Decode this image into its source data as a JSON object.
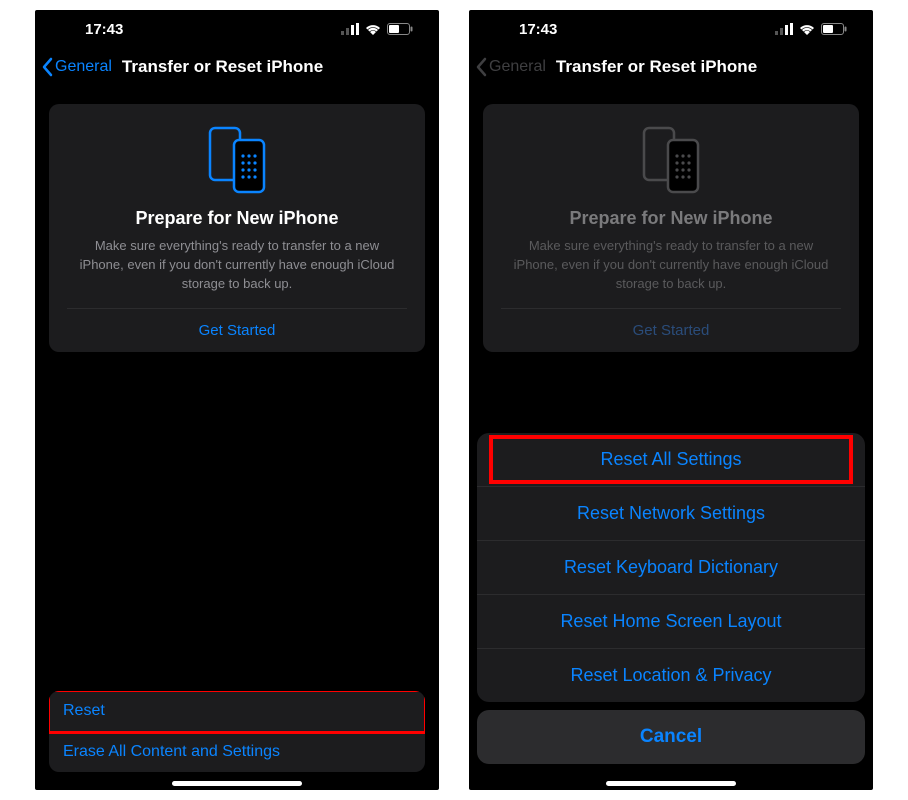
{
  "status": {
    "time": "17:43"
  },
  "nav": {
    "back_label": "General",
    "title": "Transfer or Reset iPhone"
  },
  "card": {
    "title": "Prepare for New iPhone",
    "desc": "Make sure everything's ready to transfer to a new iPhone, even if you don't currently have enough iCloud storage to back up.",
    "cta": "Get Started"
  },
  "list": {
    "reset": "Reset",
    "erase": "Erase All Content and Settings"
  },
  "sheet": {
    "reset_all": "Reset All Settings",
    "reset_network": "Reset Network Settings",
    "reset_keyboard": "Reset Keyboard Dictionary",
    "reset_home": "Reset Home Screen Layout",
    "reset_location": "Reset Location & Privacy",
    "cancel": "Cancel"
  }
}
